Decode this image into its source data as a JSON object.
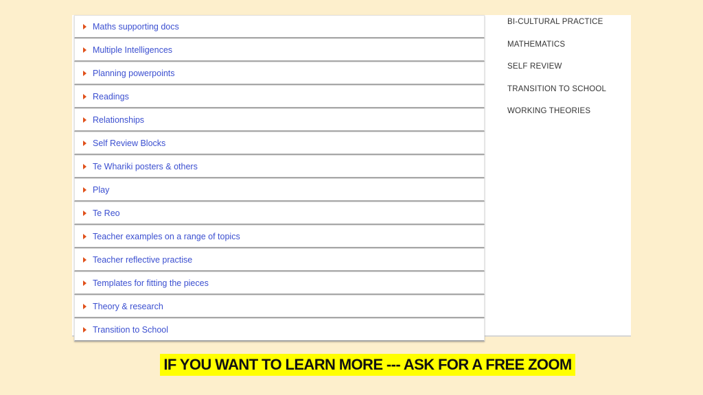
{
  "list": {
    "items": [
      {
        "label": "Maths supporting docs"
      },
      {
        "label": "Multiple Intelligences"
      },
      {
        "label": "Planning powerpoints"
      },
      {
        "label": "Readings"
      },
      {
        "label": "Relationships"
      },
      {
        "label": "Self Review Blocks"
      },
      {
        "label": "Te Whariki posters & others"
      },
      {
        "label": "Play"
      },
      {
        "label": "Te Reo"
      },
      {
        "label": "Teacher examples on a range of topics"
      },
      {
        "label": "Teacher reflective practise"
      },
      {
        "label": "Templates for fitting the pieces"
      },
      {
        "label": "Theory & research"
      },
      {
        "label": "Transition to School"
      }
    ]
  },
  "sidebar": {
    "items": [
      {
        "label": "BI-CULTURAL PRACTICE"
      },
      {
        "label": "MATHEMATICS"
      },
      {
        "label": "SELF REVIEW"
      },
      {
        "label": "TRANSITION TO SCHOOL"
      },
      {
        "label": "WORKING THEORIES"
      }
    ]
  },
  "banner": {
    "text": "IF YOU WANT TO LEARN MORE --- ASK FOR A FREE ZOOM"
  },
  "colors": {
    "background": "#fdefcc",
    "link": "#3b4fd0",
    "triangle": "#e0501a",
    "banner": "#ffff00"
  }
}
